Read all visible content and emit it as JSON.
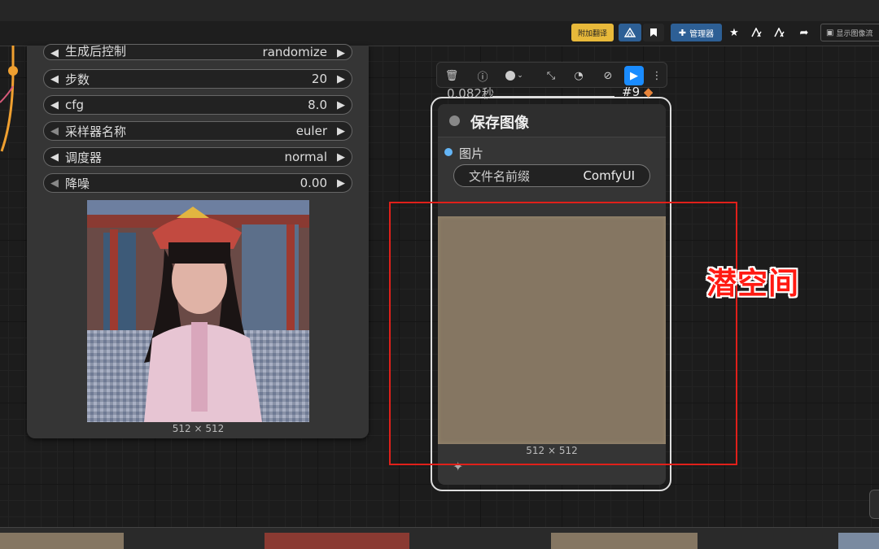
{
  "toolbar": {
    "translate_btn": "附加翻译",
    "manager_btn": "管理器",
    "show_image_btn": "显示图像流",
    "colors": {
      "translate_bg": "#e8b93a",
      "manager_bg": "#2d5f95",
      "accent": "#1a8cff"
    }
  },
  "ksampler": {
    "widgets": [
      {
        "label": "生成后控制",
        "value": "randomize"
      },
      {
        "label": "步数",
        "value": "20"
      },
      {
        "label": "cfg",
        "value": "8.0"
      },
      {
        "label": "采样器名称",
        "value": "euler"
      },
      {
        "label": "调度器",
        "value": "normal"
      },
      {
        "label": "降噪",
        "value": "0.00"
      }
    ],
    "preview_size": "512 × 512"
  },
  "node_toolbar": {
    "icons": [
      "trash-icon",
      "info-icon",
      "color-icon",
      "collapse-icon",
      "bypass-icon",
      "mute-icon",
      "run-icon",
      "more-icon"
    ]
  },
  "save_node": {
    "timing": "0.082秒",
    "node_id": "#9",
    "title": "保存图像",
    "input_label": "图片",
    "widget": {
      "label": "文件名前缀",
      "value": "ComfyUI"
    },
    "preview_size": "512 × 512"
  },
  "annotation": {
    "text": "潜空间",
    "color": "#e0201a"
  }
}
